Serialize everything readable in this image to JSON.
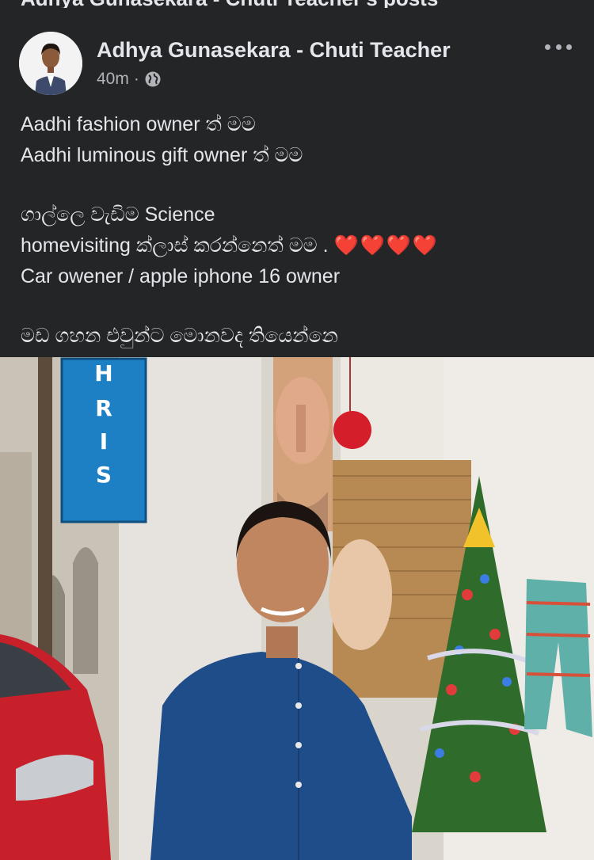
{
  "page": {
    "header_title": "Adhya Gunasekara - Chuti Teacher's posts"
  },
  "post": {
    "author": "Adhya Gunasekara - Chuti Teacher",
    "time": "40m",
    "privacy_icon": "globe-icon",
    "more_icon": "more-options-icon",
    "lines": [
      "Aadhi fashion owner ත් මම",
      "Aadhi luminous gift owner ත් මම",
      "ගාල්ලෙ වැඩිම Science",
      "homevisiting ක්ලාස්  කරන්නෙත් මම .",
      "Car owener / apple iphone 16 owner",
      "මඩ ගහන එවුන්ට මොනවද තියෙන්නෙ"
    ],
    "hearts": "❤️❤️❤️❤️"
  },
  "photo": {
    "sign_letters": [
      "H",
      "R",
      "I",
      "S"
    ]
  },
  "colors": {
    "background": "#242526",
    "text_primary": "#e4e6eb",
    "text_secondary": "#b0b3b8",
    "heart": "#e0242a"
  }
}
